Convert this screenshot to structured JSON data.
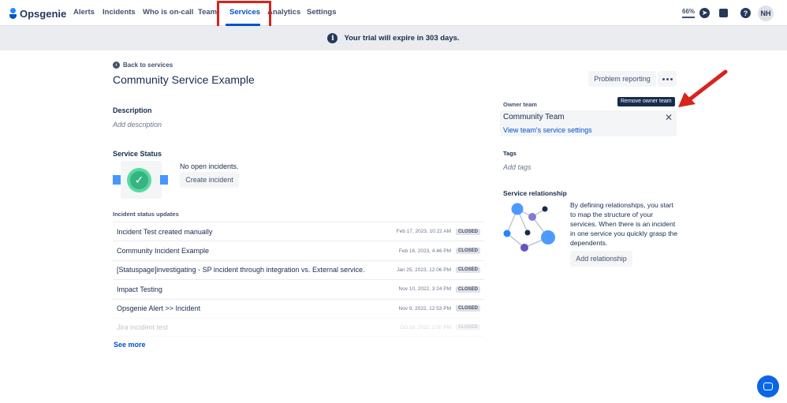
{
  "nav": {
    "logo": "Opsgenie",
    "items": [
      "Alerts",
      "Incidents",
      "Who is on-call",
      "Teams",
      "Services",
      "Analytics",
      "Settings"
    ],
    "zoom": "66%",
    "help": "?",
    "avatar": "NH"
  },
  "banner": {
    "text": "Your trial will expire in 303 days."
  },
  "page": {
    "back": "Back to services",
    "title": "Community Service Example",
    "problem_reporting": "Problem reporting"
  },
  "description": {
    "label": "Description",
    "placeholder": "Add description"
  },
  "status": {
    "label": "Service Status",
    "no_incidents": "No open incidents.",
    "create": "Create incident"
  },
  "updates": {
    "label": "Incident status updates",
    "rows": [
      {
        "title": "Incident Test created manually",
        "date": "Feb 17, 2023, 10:22 AM",
        "status": "CLOSED"
      },
      {
        "title": "Community Incident Example",
        "date": "Feb 16, 2023, 4:46 PM",
        "status": "CLOSED"
      },
      {
        "title": "[Statuspage]investigating - SP incident through integration vs. External service.",
        "date": "Jan 25, 2023, 12:06 PM",
        "status": "CLOSED"
      },
      {
        "title": "Impact Testing",
        "date": "Nov 10, 2022, 3:24 PM",
        "status": "CLOSED"
      },
      {
        "title": "Opsgenie Alert >> Incident",
        "date": "Nov 9, 2022, 12:53 PM",
        "status": "CLOSED"
      },
      {
        "title": "Jira incident test",
        "date": "Oct 18, 2022, 2:00 PM",
        "status": "CLOSED"
      }
    ],
    "see_more": "See more"
  },
  "owner": {
    "label": "Owner team",
    "team": "Community Team",
    "link": "View team's service settings",
    "tooltip": "Remove owner team"
  },
  "tags": {
    "label": "Tags",
    "placeholder": "Add tags"
  },
  "relationship": {
    "label": "Service relationship",
    "text": "By defining relationships, you start to map the structure of your services. When there is an incident in one service you quickly grasp the dependents.",
    "button": "Add relationship"
  },
  "colors": {
    "accent": "#0052cc",
    "annotation": "#d7241d",
    "success": "#36b37e"
  }
}
